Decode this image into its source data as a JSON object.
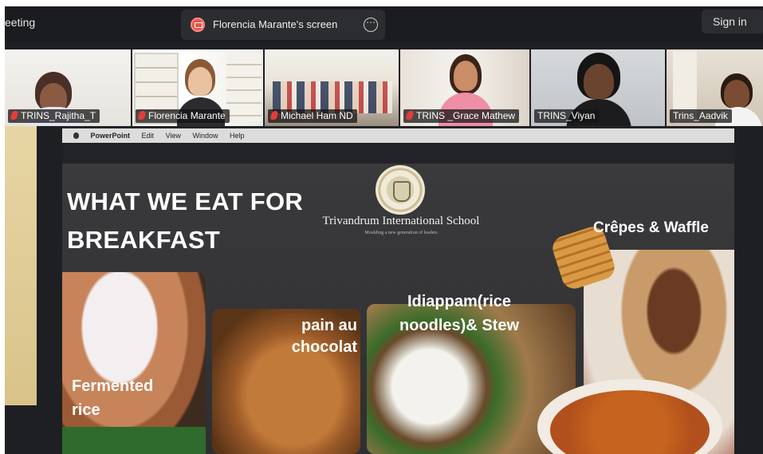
{
  "topbar": {
    "meeting_title": "eeting",
    "share_label": "Florencia Marante's screen",
    "more_icon": "ellipsis-icon",
    "signin_label": "Sign in"
  },
  "participants": [
    {
      "name": "TRINS_Rajitha_T",
      "muted": true
    },
    {
      "name": "Florencia Marante",
      "muted": true
    },
    {
      "name": "Michael Ham ND",
      "muted": true
    },
    {
      "name": "TRINS _Grace Mathew",
      "muted": true
    },
    {
      "name": "TRINS_Viyan",
      "muted": false
    },
    {
      "name": "Trins_Aadvik",
      "muted": false,
      "active_speaker": true
    }
  ],
  "mac_menu": [
    "PowerPoint",
    "Edit",
    "View",
    "Window",
    "Help"
  ],
  "slide": {
    "title_line1": "WHAT WE EAT FOR",
    "title_line2": "BREAKFAST",
    "school_name": "Trivandrum International School",
    "school_tagline": "Moulding a new generation of leaders",
    "foods": [
      {
        "label_line1": "Fermented",
        "label_line2": "rice"
      },
      {
        "label_line1": "pain au",
        "label_line2": "chocolat"
      },
      {
        "label_line1": "Idiappam(rice",
        "label_line2": "noodles)& Stew"
      },
      {
        "label_line1": "Crêpes & Waffle",
        "label_line2": ""
      }
    ]
  },
  "colors": {
    "active_speaker_border": "#2bd16a",
    "mute_icon": "#e63b3b",
    "share_icon": "#e8534b"
  }
}
